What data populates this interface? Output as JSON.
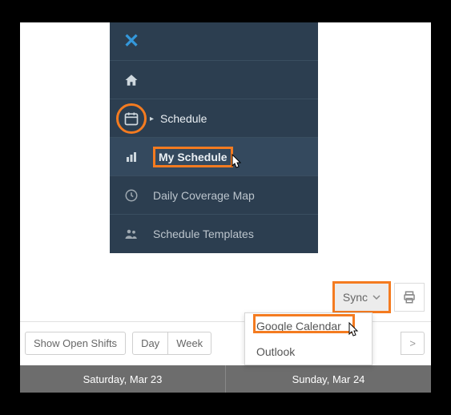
{
  "sidebar": {
    "items": [
      {
        "label": "Schedule"
      },
      {
        "label": "My Schedule"
      },
      {
        "label": "Daily Coverage Map"
      },
      {
        "label": "Schedule Templates"
      }
    ]
  },
  "toolbar": {
    "sync_label": "Sync"
  },
  "sync_menu": {
    "google": "Google Calendar",
    "outlook": "Outlook"
  },
  "filters": {
    "open_shifts": "Show Open Shifts",
    "day": "Day",
    "week": "Week"
  },
  "days": {
    "sat": "Saturday, Mar 23",
    "sun": "Sunday, Mar 24"
  },
  "colors": {
    "highlight": "#f47b20",
    "sidebar_bg": "#2c3e50"
  }
}
